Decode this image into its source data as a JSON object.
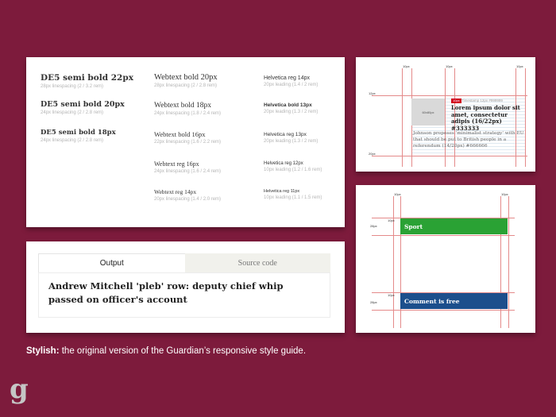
{
  "type_specimens": {
    "col1": [
      {
        "name": "DE5 semi bold 22px",
        "meta": "28px linespacing (2 / 3.2 rem)"
      },
      {
        "name": "DE5 semi bold 20px",
        "meta": "24px linespacing (2 / 2.8 rem)"
      },
      {
        "name": "DE5 semi bold 18px",
        "meta": "24px linespacing (2 / 2.8 rem)"
      }
    ],
    "col2": [
      {
        "name": "Webtext bold 20px",
        "meta": "28px linespacing (2 / 2.8 rem)"
      },
      {
        "name": "Webtext bold 18px",
        "meta": "24px linespacing (1.8 / 2.4 rem)"
      },
      {
        "name": "Webtext bold 16px",
        "meta": "22px linespacing (1.6 / 2.2 rem)"
      },
      {
        "name": "Webtext reg 16px",
        "meta": "24px linespacing (1.6 / 2.4 rem)"
      },
      {
        "name": "Webtext reg 14px",
        "meta": "20px linespacing (1.4 / 2.0 rem)"
      }
    ],
    "col3": [
      {
        "name": "Helvetica reg 14px",
        "meta": "20px leading (1.4 / 2 rem)"
      },
      {
        "name": "Helvetica bold 13px",
        "meta": "20px leading (1.3 / 2 rem)"
      },
      {
        "name": "Helvetica reg 13px",
        "meta": "20px leading (1.3 / 2 rem)"
      },
      {
        "name": "Helvetica reg 12px",
        "meta": "10px leading (1.2 / 1.6 rem)"
      },
      {
        "name": "Helvetica reg 11px",
        "meta": "10px leading (1.1 / 1.5 rem)"
      }
    ]
  },
  "output_panel": {
    "tab_output": "Output",
    "tab_source": "Source code",
    "headline": "Andrew Mitchell 'pleb' row: deputy chief whip passed on officer's account"
  },
  "spacing_diagram": {
    "top_labels": [
      "10px",
      "10px",
      "10px"
    ],
    "left_label_top": "12px",
    "left_label_bottom": "20px",
    "image_label": "60x80px",
    "tag": "10px",
    "timestamp": "Timestamp 12px #999999",
    "headline": "Lorem ipsum dolor sit amet, consectetur adipis (16/22px) #333333",
    "trail": "Johnson proposes 'minimalist strategy' with EU that should be put to British people in a referendum (14/20px) #666666"
  },
  "section_diagram": {
    "top_left_label": "10px",
    "top_right_label": "10px",
    "row1_height_label": "28px",
    "row1_gap_label": "10px",
    "row2_height_label": "28px",
    "row2_gap_label": "10px",
    "sport_label": "Sport",
    "comment_label": "Comment is free",
    "sport_color": "#2aa234",
    "comment_color": "#1c4f8c"
  },
  "caption": {
    "bold": "Stylish:",
    "text": " the original version of the Guardian’s responsive style guide."
  },
  "logo": {
    "letter": "g"
  },
  "colors": {
    "background": "#7d1b3c",
    "guide_red": "#e48a8a",
    "tag_red": "#d0021b"
  }
}
